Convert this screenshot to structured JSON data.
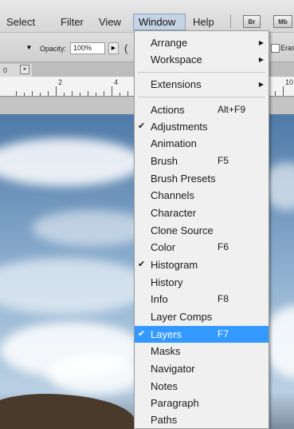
{
  "menubar": {
    "items": [
      "Select",
      "Filter",
      "View",
      "Window",
      "Help"
    ],
    "app_icons": [
      "Br",
      "Mb"
    ]
  },
  "options": {
    "opacity_label": "Opacity:",
    "opacity_value": "100%",
    "paren": "(",
    "erase_label": "Eras"
  },
  "document": {
    "tab_label": "0",
    "close_glyph": "×"
  },
  "ruler": {
    "numbers": [
      "2",
      "4",
      "10"
    ]
  },
  "window_menu": {
    "groups": [
      [
        {
          "label": "Arrange",
          "submenu": true
        },
        {
          "label": "Workspace",
          "submenu": true
        }
      ],
      [
        {
          "label": "Extensions",
          "submenu": true
        }
      ],
      [
        {
          "label": "Actions",
          "shortcut": "Alt+F9"
        },
        {
          "label": "Adjustments",
          "checked": true
        },
        {
          "label": "Animation"
        },
        {
          "label": "Brush",
          "shortcut": "F5"
        },
        {
          "label": "Brush Presets"
        },
        {
          "label": "Channels"
        },
        {
          "label": "Character"
        },
        {
          "label": "Clone Source"
        },
        {
          "label": "Color",
          "shortcut": "F6"
        },
        {
          "label": "Histogram",
          "checked": true
        },
        {
          "label": "History"
        },
        {
          "label": "Info",
          "shortcut": "F8"
        },
        {
          "label": "Layer Comps"
        },
        {
          "label": "Layers",
          "shortcut": "F7",
          "checked": true,
          "highlighted": true
        },
        {
          "label": "Masks"
        },
        {
          "label": "Navigator"
        },
        {
          "label": "Notes"
        },
        {
          "label": "Paragraph"
        },
        {
          "label": "Paths"
        }
      ]
    ],
    "check_glyph": "✔",
    "submenu_glyph": "▶"
  },
  "colors": {
    "highlight": "#3399ff",
    "menu_bg": "#f0f0f0"
  }
}
